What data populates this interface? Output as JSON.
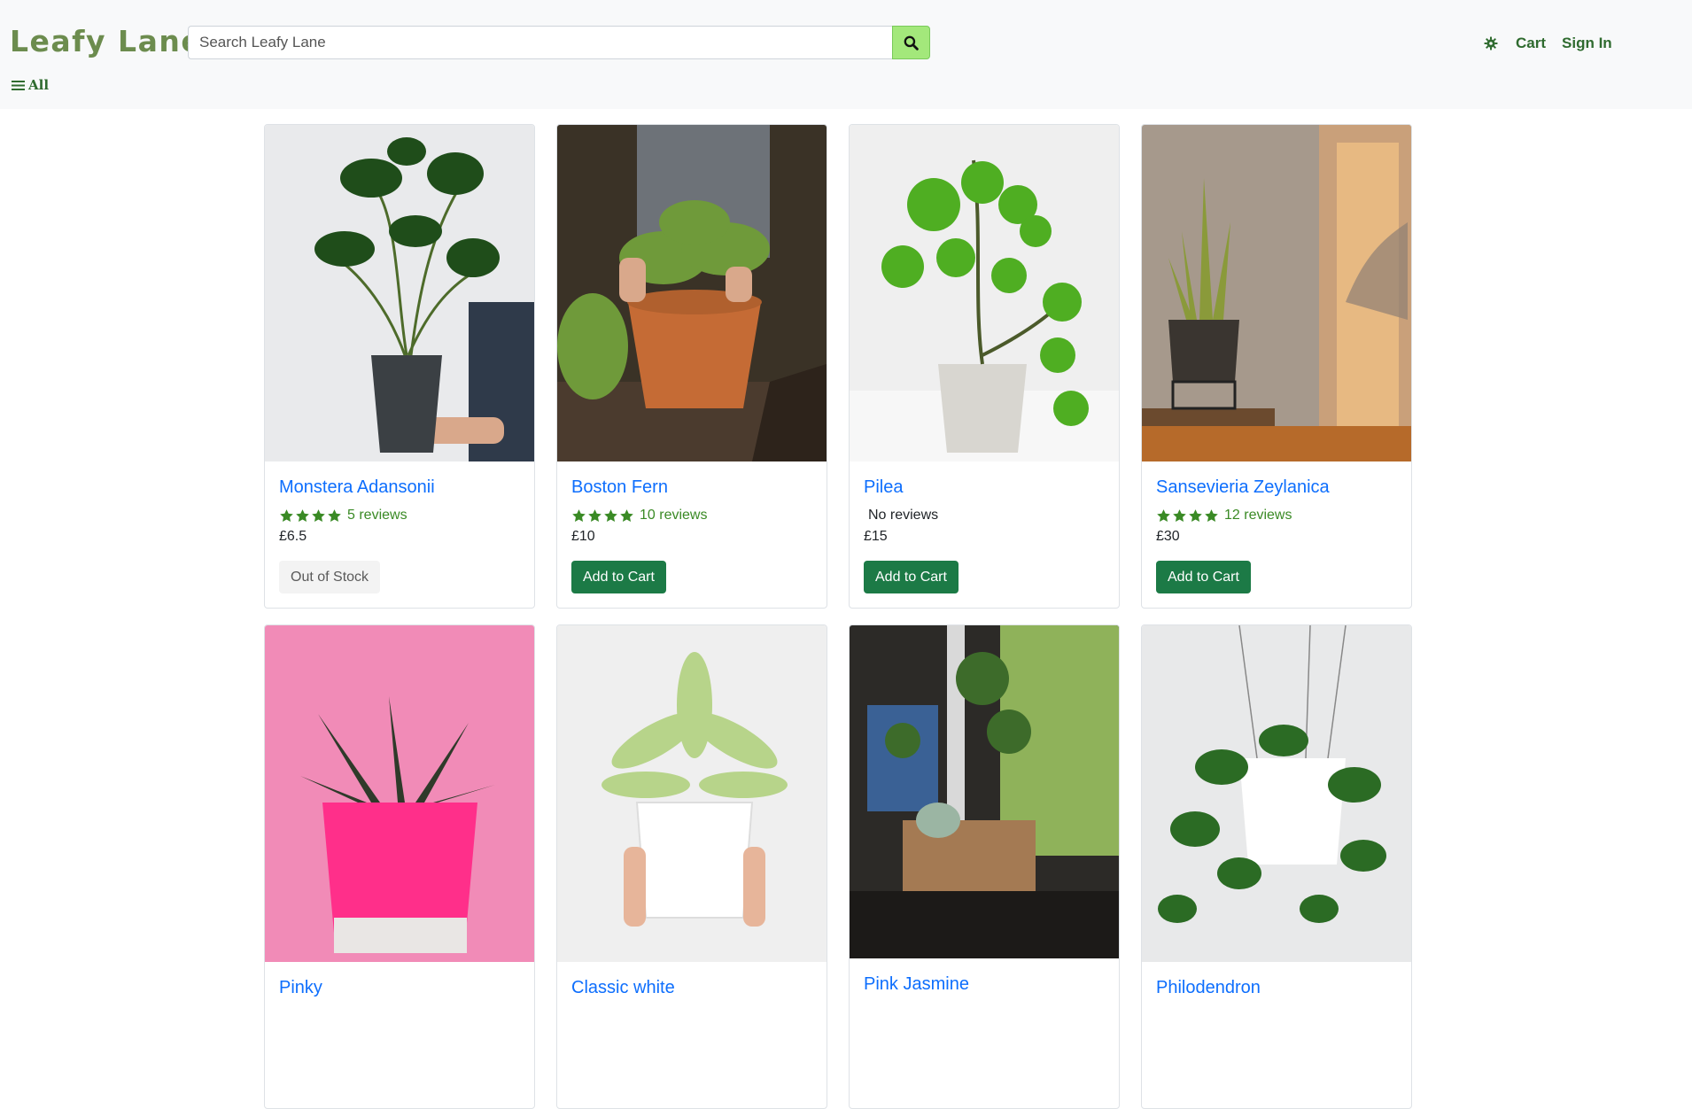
{
  "header": {
    "brand": "Leafy Lane",
    "search_placeholder": "Search Leafy Lane",
    "cart_label": "Cart",
    "signin_label": "Sign In",
    "all_label": "All"
  },
  "colors": {
    "brand": "#6c8c4e",
    "nav_link": "#2f6b2f",
    "search_button": "#a3e87b",
    "product_link": "#0d6efd",
    "rating": "#3a8a25",
    "add_to_cart": "#1c7a46"
  },
  "products": [
    {
      "name": "Monstera Adansonii",
      "stars": 4,
      "reviews": "5 reviews",
      "price": "£6.5",
      "button": "Out of Stock",
      "in_stock": false
    },
    {
      "name": "Boston Fern",
      "stars": 4,
      "reviews": "10 reviews",
      "price": "£10",
      "button": "Add to Cart",
      "in_stock": true
    },
    {
      "name": "Pilea",
      "stars": 0,
      "reviews": "No reviews",
      "price": "£15",
      "button": "Add to Cart",
      "in_stock": true
    },
    {
      "name": "Sansevieria Zeylanica",
      "stars": 4,
      "reviews": "12 reviews",
      "price": "£30",
      "button": "Add to Cart",
      "in_stock": true
    },
    {
      "name": "Pinky"
    },
    {
      "name": "Classic white"
    },
    {
      "name": "Pink Jasmine"
    },
    {
      "name": "Philodendron"
    }
  ]
}
